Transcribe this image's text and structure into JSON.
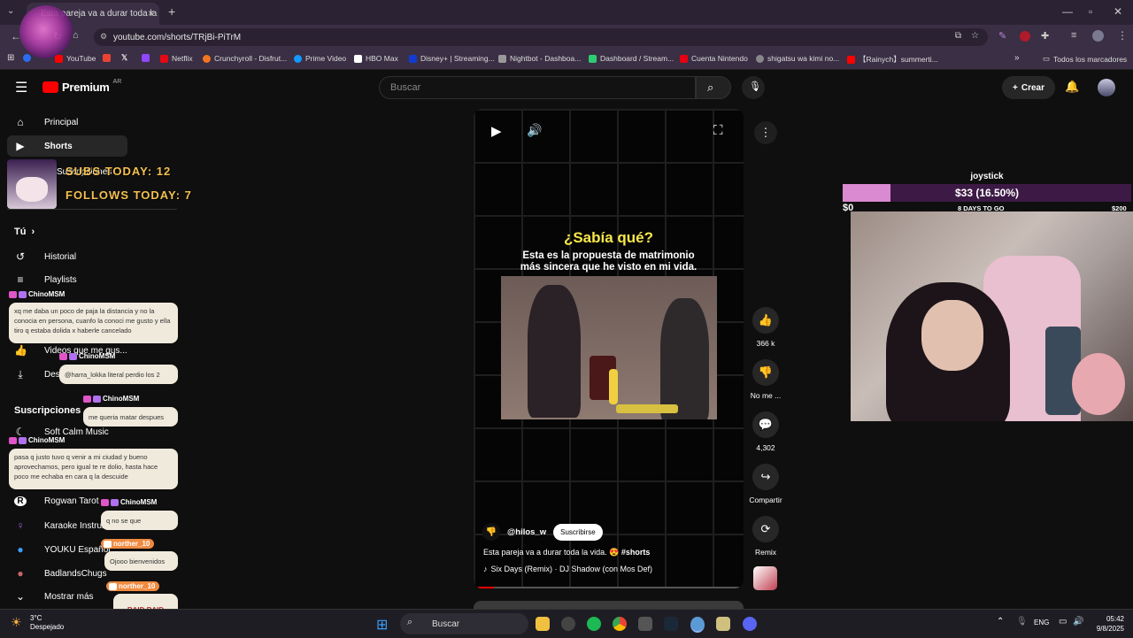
{
  "browser": {
    "tab_title": "Esta pareja va a durar toda la vi...",
    "url": "youtube.com/shorts/TRjBi-PiTrM",
    "bookmarks": [
      "YouTube",
      "Netflix",
      "Crunchyroll - Disfrut...",
      "Prime Video",
      "HBO Max",
      "Disney+ | Streaming...",
      "Nightbot - Dashboa...",
      "Dashboard / Stream...",
      "Cuenta Nintendo",
      "shigatsu wa kimi no...",
      "【Rainych】summerti..."
    ],
    "all_bookmarks": "Todos los marcadores",
    "bookmark_colors": [
      "#ff0000",
      "#e50914",
      "#f47521",
      "#1399ff",
      "#ffffff",
      "#113ccf",
      "#999999",
      "#2ecc71",
      "#e60012",
      "#888888",
      "#ff0000"
    ]
  },
  "youtube": {
    "logo": "Premium",
    "region": "AR",
    "search_placeholder": "Buscar",
    "create_label": "Crear"
  },
  "sidebar": {
    "home": "Principal",
    "shorts": "Shorts",
    "subs_partial": "Suscripciones",
    "you": "Tú",
    "history": "Historial",
    "playlists": "Playlists",
    "liked": "Videos que me gus...",
    "downloads": "Descargas",
    "subscriptions_heading": "Suscripciones",
    "channels": [
      "Soft Calm Music",
      "Rogwan Tarot",
      "Karaoke Instrum...",
      "YOUKU Español",
      "BadlandsChugs"
    ],
    "show_more": "Mostrar más"
  },
  "stream_overlay": {
    "subs_today": "SUBS TODAY: 12",
    "follows_today": "FOLLOWS TODAY: 7",
    "goal_title": "joystick",
    "goal_amount": "$33 (16.50%)",
    "goal_progress": 16.5,
    "goal_min": "$0",
    "goal_days": "8 DAYS TO GO",
    "goal_max": "$200"
  },
  "chat": [
    {
      "user": "ChinoMSM",
      "text": "xq me daba un poco de paja la distancia y no la conocia en persona, cuanfo la conoci me gusto y ella tiro q estaba dolida x haberle cancelado"
    },
    {
      "user": "ChinoMSM",
      "text": "@harra_lokka literal perdio los 2"
    },
    {
      "user": "ChinoMSM",
      "text": "me queria matar despues"
    },
    {
      "user": "ChinoMSM",
      "text": "pasa q justo tuvo q venir a mi ciudad y bueno aprovechamos, pero igual te re dolio, hasta hace poco me echaba en cara q la descuide"
    },
    {
      "user": "ChinoMSM",
      "text": "q no se que"
    },
    {
      "user": "norther_10",
      "text": "Ojooo bienvenidos"
    },
    {
      "user": "norther_10",
      "text": "RAID RAID"
    }
  ],
  "short": {
    "title_overlay": "¿Sabía qué?",
    "subtitle_line1": "Esta es la propuesta de matrimonio",
    "subtitle_line2": "más sincera que he visto en mi vida.",
    "channel": "@hilos_w",
    "subscribe": "Suscribirse",
    "description": "Esta pareja va a durar toda la vida. 😍",
    "hashtag": "#shorts",
    "music": "Six Days (Remix) · DJ Shadow (con Mos Def)",
    "likes": "366 k",
    "dislike": "No me ...",
    "comments": "4,302",
    "share": "Compartir",
    "remix": "Remix",
    "progress": 6
  },
  "taskbar": {
    "weather_temp": "3°C",
    "weather_desc": "Despejado",
    "search": "Buscar",
    "lang": "ENG",
    "time": "05:42",
    "date": "9/8/2025"
  }
}
